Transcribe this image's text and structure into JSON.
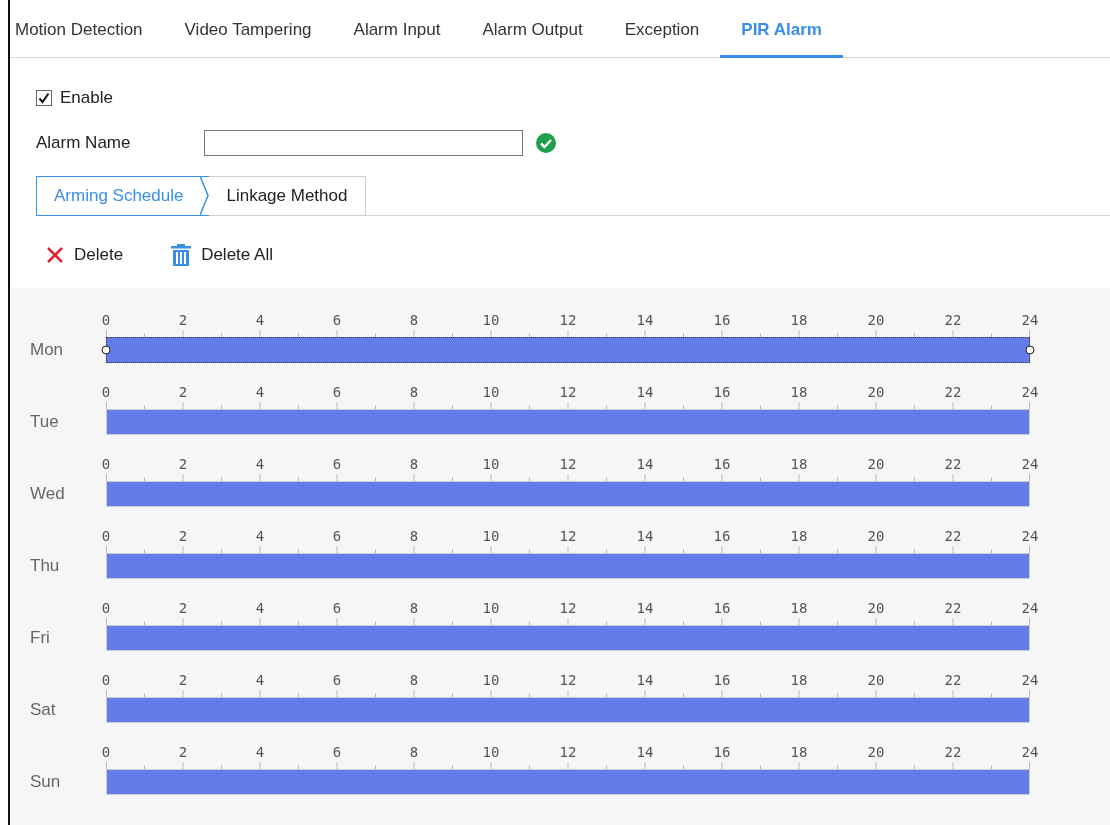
{
  "tabs": [
    {
      "label": "Motion Detection",
      "selected": false
    },
    {
      "label": "Video Tampering",
      "selected": false
    },
    {
      "label": "Alarm Input",
      "selected": false
    },
    {
      "label": "Alarm Output",
      "selected": false
    },
    {
      "label": "Exception",
      "selected": false
    },
    {
      "label": "PIR Alarm",
      "selected": true
    }
  ],
  "enable": {
    "label": "Enable",
    "checked": true
  },
  "alarm_name": {
    "label": "Alarm Name",
    "valid": true
  },
  "sub_tabs": [
    {
      "label": "Arming Schedule",
      "selected": true
    },
    {
      "label": "Linkage Method",
      "selected": false
    }
  ],
  "actions": [
    {
      "kind": "delete",
      "label": "Delete"
    },
    {
      "kind": "delete_all",
      "label": "Delete All"
    }
  ],
  "schedule": [
    {
      "day": "Mon",
      "selected": true,
      "hours": [
        "0",
        "2",
        "4",
        "6",
        "8",
        "10",
        "12",
        "14",
        "16",
        "18",
        "20",
        "22",
        "24"
      ]
    },
    {
      "day": "Tue",
      "selected": false,
      "hours": [
        "0",
        "2",
        "4",
        "6",
        "8",
        "10",
        "12",
        "14",
        "16",
        "18",
        "20",
        "22",
        "24"
      ]
    },
    {
      "day": "Wed",
      "selected": false,
      "hours": [
        "0",
        "2",
        "4",
        "6",
        "8",
        "10",
        "12",
        "14",
        "16",
        "18",
        "20",
        "22",
        "24"
      ]
    },
    {
      "day": "Thu",
      "selected": false,
      "hours": [
        "0",
        "2",
        "4",
        "6",
        "8",
        "10",
        "12",
        "14",
        "16",
        "18",
        "20",
        "22",
        "24"
      ]
    },
    {
      "day": "Fri",
      "selected": false,
      "hours": [
        "0",
        "2",
        "4",
        "6",
        "8",
        "10",
        "12",
        "14",
        "16",
        "18",
        "20",
        "22",
        "24"
      ]
    },
    {
      "day": "Sat",
      "selected": false,
      "hours": [
        "0",
        "2",
        "4",
        "6",
        "8",
        "10",
        "12",
        "14",
        "16",
        "18",
        "20",
        "22",
        "24"
      ]
    },
    {
      "day": "Sun",
      "selected": false,
      "hours": [
        "0",
        "2",
        "4",
        "6",
        "8",
        "10",
        "12",
        "14",
        "16",
        "18",
        "20",
        "22",
        "24"
      ]
    }
  ]
}
